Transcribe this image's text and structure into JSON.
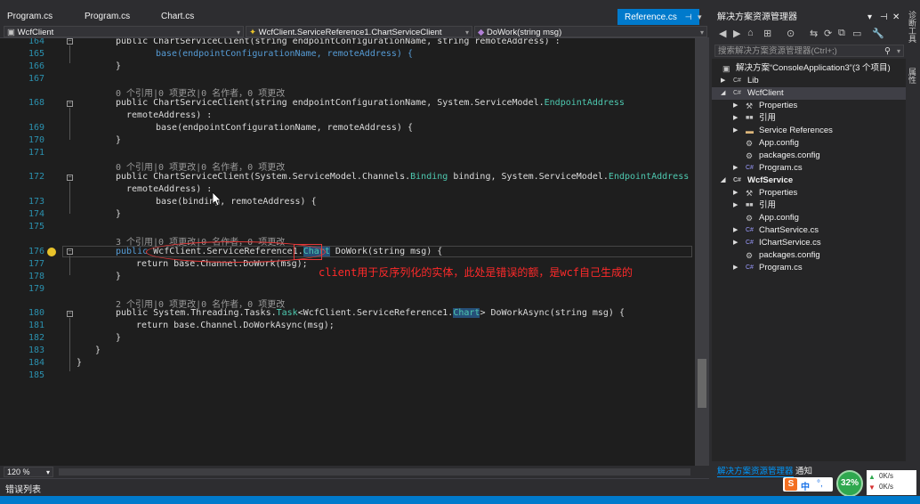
{
  "tabs": [
    {
      "label": "Program.cs"
    },
    {
      "label": "Program.cs"
    },
    {
      "label": "Chart.cs"
    },
    {
      "label": "Reference.cs"
    }
  ],
  "active_tab_pin": "⊣",
  "active_tab_close": "✕",
  "tab_overflow": "▾",
  "navbar": {
    "project": "WcfClient",
    "class": "WcfClient.ServiceReference1.ChartServiceClient",
    "member": "DoWork(string msg)"
  },
  "lens": {
    "a": "0 个引用|0 项更改|0 名作者，0 项更改",
    "b": "0 个引用|0 项更改|0 名作者，0 项更改",
    "c": "3 个引用|0 项更改|0 名作者，0 项更改",
    "d": "2 个引用|0 项更改|0 名作者，0 项更改"
  },
  "line_numbers": [
    "164",
    "165",
    "166",
    "167",
    "168",
    "169",
    "170",
    "171",
    "172",
    "173",
    "174",
    "175",
    "176",
    "177",
    "178",
    "179",
    "180",
    "181",
    "182",
    "183",
    "184",
    "185"
  ],
  "code": {
    "l164": "public ChartServiceClient(string endpointConfigurationName, string remoteAddress) :",
    "l165": "base(endpointConfigurationName, remoteAddress) {",
    "l166": "}",
    "l168a": "public ChartServiceClient(string endpointConfigurationName, System.ServiceModel.",
    "l168b": "EndpointAddress",
    "l168c": "remoteAddress) :",
    "l169": "base(endpointConfigurationName, remoteAddress) {",
    "l170": "}",
    "l172a": "public ChartServiceClient(System.ServiceModel.Channels.",
    "l172b": "Binding",
    "l172c": " binding, System.ServiceModel.",
    "l172d": "EndpointAddress",
    "l172e": "remoteAddress) :",
    "l173": "base(binding, remoteAddress) {",
    "l174": "}",
    "l176a": "public ",
    "l176b": "WcfClient.ServiceReference1.",
    "l176c": "Chart",
    "l176d": " DoWork(string msg) {",
    "l177": "return base.Channel.DoWork(msg);",
    "l178": "}",
    "l180a": "public System.Threading.Tasks.",
    "l180b": "Task",
    "l180c": "<WcfClient.ServiceReference1.",
    "l180d": "Chart",
    "l180e": "> DoWorkAsync(string msg) {",
    "l181": "return base.Channel.DoWorkAsync(msg);",
    "l182": "}",
    "l183": "}",
    "l184": "}"
  },
  "annotation": "client用于反序列化的实体，此处是错误的额，是wcf自己生成的",
  "zoom": "120 %",
  "error_list": "错误列表",
  "solution_explorer": {
    "title": "解决方案资源管理器",
    "title_icons": [
      "▾",
      "⊣",
      "✕"
    ],
    "search_placeholder": "搜索解决方案资源管理器(Ctrl+;)",
    "toolbar_icons": [
      "◀",
      "▶",
      "⌂",
      "⊞",
      "⊙",
      "⇆",
      "⟳",
      "⧉",
      "▭",
      "🔧"
    ],
    "tree": [
      {
        "label": "解决方案“ConsoleApplication3”(3 个项目)",
        "icon": "▣"
      },
      {
        "label": "Lib",
        "icon": "C#"
      },
      {
        "label": "WcfClient",
        "icon": "C#"
      },
      {
        "label": "Properties",
        "icon": "🔧"
      },
      {
        "label": "引用",
        "icon": "■■"
      },
      {
        "label": "Service References",
        "icon": "▬"
      },
      {
        "label": "App.config",
        "icon": "⚙"
      },
      {
        "label": "packages.config",
        "icon": "⚙"
      },
      {
        "label": "Program.cs",
        "icon": "C#"
      },
      {
        "label": "WcfService",
        "icon": "C#"
      },
      {
        "label": "Properties",
        "icon": "🔧"
      },
      {
        "label": "引用",
        "icon": "■■"
      },
      {
        "label": "App.config",
        "icon": "⚙"
      },
      {
        "label": "ChartService.cs",
        "icon": "C#"
      },
      {
        "label": "IChartService.cs",
        "icon": "C#"
      },
      {
        "label": "packages.config",
        "icon": "⚙"
      },
      {
        "label": "Program.cs",
        "icon": "C#"
      }
    ],
    "tabs": [
      "解决方案资源管理器",
      "通知"
    ]
  },
  "right_rail": [
    "诊断工具",
    "属性"
  ],
  "tray": {
    "percent": "32%",
    "ime_cn": "中",
    "ime_punct": "°,",
    "up": "0K/s",
    "down": "0K/s"
  },
  "colors": {
    "accent": "#007acc",
    "editor_bg": "#1e1e1e",
    "keyword": "#569cd6",
    "type": "#4ec9b0",
    "line_number": "#2b91af",
    "annotation": "#ff2a2a"
  }
}
